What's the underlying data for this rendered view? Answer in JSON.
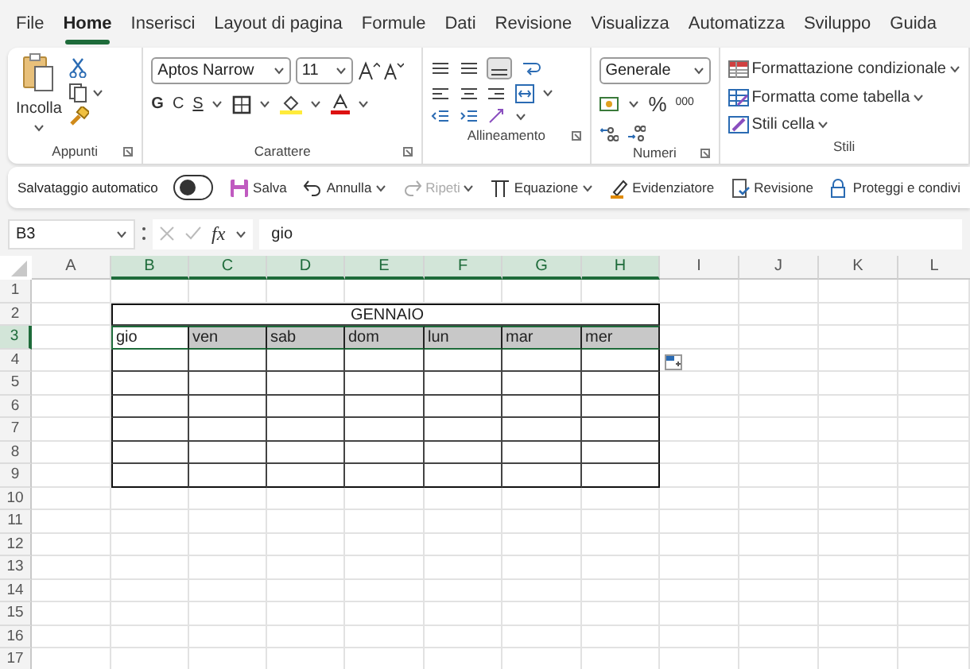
{
  "menu_tabs": [
    {
      "label": "File",
      "selected": false
    },
    {
      "label": "Home",
      "selected": true
    },
    {
      "label": "Inserisci",
      "selected": false
    },
    {
      "label": "Layout di pagina",
      "selected": false
    },
    {
      "label": "Formule",
      "selected": false
    },
    {
      "label": "Dati",
      "selected": false
    },
    {
      "label": "Revisione",
      "selected": false
    },
    {
      "label": "Visualizza",
      "selected": false
    },
    {
      "label": "Automatizza",
      "selected": false
    },
    {
      "label": "Sviluppo",
      "selected": false
    },
    {
      "label": "Guida",
      "selected": false
    }
  ],
  "ribbon": {
    "clipboard": {
      "paste_label": "Incolla",
      "group_label": "Appunti"
    },
    "font": {
      "font_name": "Aptos Narrow",
      "font_size": "11",
      "bold": "G",
      "italic": "C",
      "underline": "S",
      "group_label": "Carattere"
    },
    "alignment": {
      "group_label": "Allineamento"
    },
    "number": {
      "format": "Generale",
      "percent": "%",
      "thousands": "000",
      "group_label": "Numeri"
    },
    "styles": {
      "items": [
        "Formattazione condizionale",
        "Formatta come tabella",
        "Stili cella"
      ],
      "group_label": "Stili"
    }
  },
  "quick_access": {
    "autosave": {
      "label": "Salvataggio automatico",
      "on": false
    },
    "items": [
      {
        "kind": "save",
        "label": "Salva",
        "disabled": false,
        "dropdown": false
      },
      {
        "kind": "undo",
        "label": "Annulla",
        "disabled": false,
        "dropdown": true
      },
      {
        "kind": "redo",
        "label": "Ripeti",
        "disabled": true,
        "dropdown": true
      },
      {
        "kind": "equation",
        "label": "Equazione",
        "disabled": false,
        "dropdown": true
      },
      {
        "kind": "highlighter",
        "label": "Evidenziatore",
        "disabled": false,
        "dropdown": false
      },
      {
        "kind": "review",
        "label": "Revisione",
        "disabled": false,
        "dropdown": false
      },
      {
        "kind": "protect",
        "label": "Proteggi e condivi",
        "disabled": false,
        "dropdown": false
      }
    ]
  },
  "formula_bar": {
    "cell_ref": "B3",
    "function_label": "fx",
    "value": "gio"
  },
  "sheet": {
    "columns": [
      {
        "label": "A",
        "selected": false,
        "in_table": false
      },
      {
        "label": "B",
        "selected": true,
        "in_table": true
      },
      {
        "label": "C",
        "selected": true,
        "in_table": true
      },
      {
        "label": "D",
        "selected": true,
        "in_table": true
      },
      {
        "label": "E",
        "selected": true,
        "in_table": true
      },
      {
        "label": "F",
        "selected": true,
        "in_table": true
      },
      {
        "label": "G",
        "selected": true,
        "in_table": true
      },
      {
        "label": "H",
        "selected": true,
        "in_table": true
      },
      {
        "label": "I",
        "selected": false,
        "in_table": false
      },
      {
        "label": "J",
        "selected": false,
        "in_table": false
      },
      {
        "label": "K",
        "selected": false,
        "in_table": false
      },
      {
        "label": "L",
        "selected": false,
        "in_table": false
      }
    ],
    "rows": [
      {
        "label": "1",
        "selected": false,
        "kind": "blank"
      },
      {
        "label": "2",
        "selected": false,
        "kind": "title",
        "text": "GENNAIO"
      },
      {
        "label": "3",
        "selected": true,
        "kind": "header",
        "cells": [
          "gio",
          "ven",
          "sab",
          "dom",
          "lun",
          "mar",
          "mer"
        ]
      },
      {
        "label": "4",
        "selected": false,
        "kind": "table"
      },
      {
        "label": "5",
        "selected": false,
        "kind": "table"
      },
      {
        "label": "6",
        "selected": false,
        "kind": "table"
      },
      {
        "label": "7",
        "selected": false,
        "kind": "table"
      },
      {
        "label": "8",
        "selected": false,
        "kind": "table"
      },
      {
        "label": "9",
        "selected": false,
        "kind": "table"
      },
      {
        "label": "10",
        "selected": false,
        "kind": "blank"
      },
      {
        "label": "11",
        "selected": false,
        "kind": "blank"
      },
      {
        "label": "12",
        "selected": false,
        "kind": "blank"
      },
      {
        "label": "13",
        "selected": false,
        "kind": "blank"
      },
      {
        "label": "14",
        "selected": false,
        "kind": "blank"
      },
      {
        "label": "15",
        "selected": false,
        "kind": "blank"
      },
      {
        "label": "16",
        "selected": false,
        "kind": "blank"
      },
      {
        "label": "17",
        "selected": false,
        "kind": "blank"
      }
    ]
  }
}
